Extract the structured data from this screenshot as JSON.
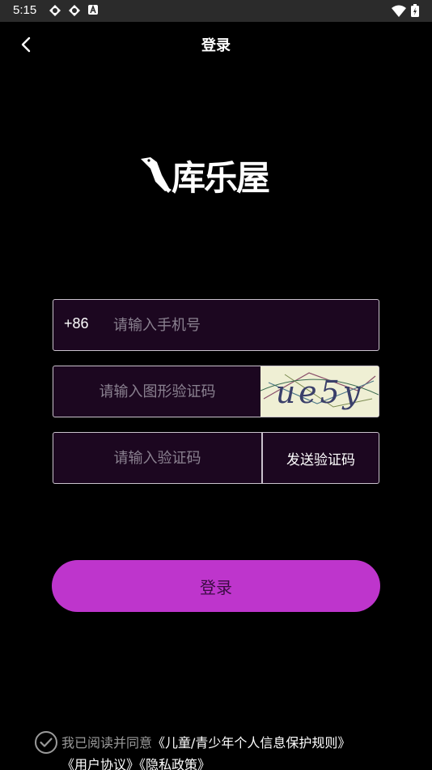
{
  "status_bar": {
    "time": "5:15",
    "left_icons": [
      "vpn-key-icon",
      "vpn-key-icon",
      "a-notification-icon"
    ],
    "right_icons": [
      "wifi-icon",
      "battery-icon"
    ]
  },
  "top_bar": {
    "title": "登录",
    "back_icon": "chevron-left-icon"
  },
  "logo": {
    "text": "库乐屋",
    "icon": "bird-icon"
  },
  "form": {
    "phone": {
      "country_code": "+86",
      "placeholder": "请输入手机号",
      "value": ""
    },
    "captcha": {
      "placeholder": "请输入图形验证码",
      "value": "",
      "image_text": "ue5y"
    },
    "sms_code": {
      "placeholder": "请输入验证码",
      "value": "",
      "send_label": "发送验证码"
    }
  },
  "login_button": {
    "label": "登录"
  },
  "agreement": {
    "checked": false,
    "prefix": "我已阅读并同意",
    "links": [
      "《儿童/青少年个人信息保护规则》",
      "《用户协议》",
      "《隐私政策》"
    ]
  },
  "colors": {
    "background": "#000000",
    "field_bg": "#1c0720",
    "accent": "#be35cc",
    "button_text": "#3a0c42"
  }
}
